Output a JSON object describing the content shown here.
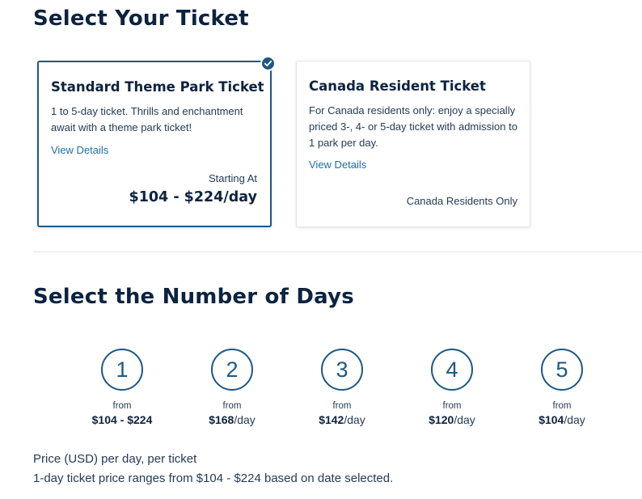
{
  "ticket_section": {
    "title": "Select Your Ticket",
    "cards": [
      {
        "title": "Standard Theme Park Ticket",
        "description": "1 to 5-day ticket. Thrills and enchantment await with a theme park ticket!",
        "link": "View Details",
        "starting_label": "Starting At",
        "price": "$104 - $224/day",
        "selected": true
      },
      {
        "title": "Canada Resident Ticket",
        "description": "For Canada residents only: enjoy a specially priced 3-, 4- or 5-day ticket with admission to 1 park per day.",
        "link": "View Details",
        "footer": "Canada Residents Only",
        "selected": false
      }
    ]
  },
  "days_section": {
    "title": "Select the Number of Days",
    "days": [
      {
        "number": "1",
        "from": "from",
        "amount": "$104 - $224",
        "unit": ""
      },
      {
        "number": "2",
        "from": "from",
        "amount": "$168",
        "unit": "/day"
      },
      {
        "number": "3",
        "from": "from",
        "amount": "$142",
        "unit": "/day"
      },
      {
        "number": "4",
        "from": "from",
        "amount": "$120",
        "unit": "/day"
      },
      {
        "number": "5",
        "from": "from",
        "amount": "$104",
        "unit": "/day"
      }
    ]
  },
  "notes": {
    "line1": "Price (USD) per day, per ticket",
    "line2": "1-day ticket price ranges from $104 - $224 based on date selected."
  },
  "colors": {
    "heading": "#0c2340",
    "accent": "#1e5883",
    "link": "#1e6fa8",
    "divider": "#dfe3e8"
  },
  "icons": {
    "selected_check": "check-circle-icon"
  }
}
